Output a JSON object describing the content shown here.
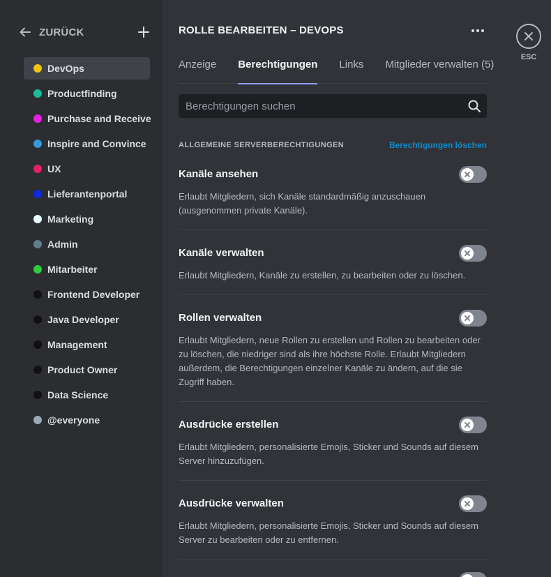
{
  "sidebar": {
    "back_label": "ZURÜCK",
    "roles": [
      {
        "label": "DevOps",
        "color": "#f1c40f",
        "active": true
      },
      {
        "label": "Productfinding",
        "color": "#1abc9c"
      },
      {
        "label": "Purchase and Receive",
        "color": "#e91ee6"
      },
      {
        "label": "Inspire and Convince",
        "color": "#3498db"
      },
      {
        "label": "UX",
        "color": "#e91e63"
      },
      {
        "label": "Lieferantenportal",
        "color": "#0a2be3"
      },
      {
        "label": "Marketing",
        "color": "#e8ffff"
      },
      {
        "label": "Admin",
        "color": "#607d8b"
      },
      {
        "label": "Mitarbeiter",
        "color": "#2ecc40"
      },
      {
        "label": "Frontend Developer",
        "color": "#111111"
      },
      {
        "label": "Java Developer",
        "color": "#111111"
      },
      {
        "label": "Management",
        "color": "#111111"
      },
      {
        "label": "Product Owner",
        "color": "#111111"
      },
      {
        "label": "Data Science",
        "color": "#111111"
      },
      {
        "label": "@everyone",
        "color": "#99aab5"
      }
    ]
  },
  "header": {
    "title": "ROLLE BEARBEITEN – DEVOPS"
  },
  "tabs": [
    {
      "label": "Anzeige"
    },
    {
      "label": "Berechtigungen",
      "active": true
    },
    {
      "label": "Links"
    },
    {
      "label": "Mitglieder verwalten (5)"
    }
  ],
  "search": {
    "placeholder": "Berechtigungen suchen"
  },
  "section": {
    "title": "ALLGEMEINE SERVERBERECHTIGUNGEN",
    "clear_label": "Berechtigungen löschen"
  },
  "permissions": [
    {
      "name": "Kanäle ansehen",
      "description": "Erlaubt Mitgliedern, sich Kanäle standardmäßig anzuschauen (ausgenommen private Kanäle).",
      "enabled": false
    },
    {
      "name": "Kanäle verwalten",
      "description": "Erlaubt Mitgliedern, Kanäle zu erstellen, zu bearbeiten oder zu löschen.",
      "enabled": false
    },
    {
      "name": "Rollen verwalten",
      "description": "Erlaubt Mitgliedern, neue Rollen zu erstellen und Rollen zu bearbeiten oder zu löschen, die niedriger sind als ihre höchste Rolle. Erlaubt Mitgliedern außerdem, die Berechtigungen einzelner Kanäle zu ändern, auf die sie Zugriff haben.",
      "enabled": false
    },
    {
      "name": "Ausdrücke erstellen",
      "description": "Erlaubt Mitgliedern, personalisierte Emojis, Sticker und Sounds auf diesem Server hinzuzufügen.",
      "enabled": false
    },
    {
      "name": "Ausdrücke verwalten",
      "description": "Erlaubt Mitgliedern, personalisierte Emojis, Sticker und Sounds auf diesem Server zu bearbeiten oder zu entfernen.",
      "enabled": false
    }
  ],
  "close": {
    "esc_label": "ESC"
  }
}
